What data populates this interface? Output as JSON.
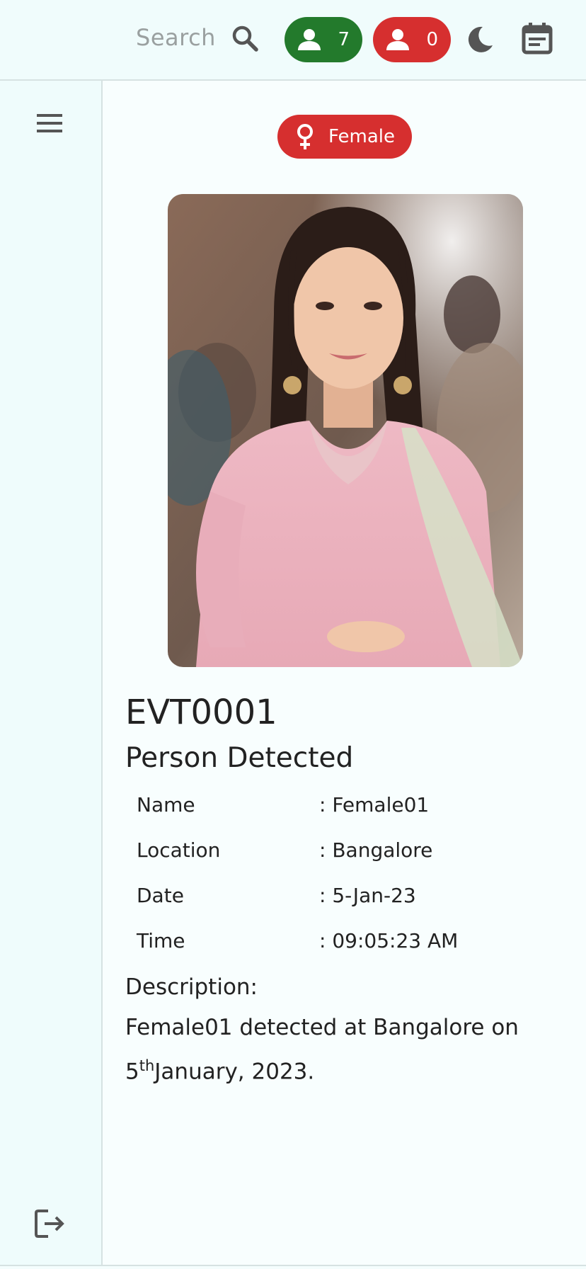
{
  "topbar": {
    "search_label": "Search",
    "icons": {
      "search": "search-icon",
      "theme": "moon-icon",
      "calendar": "calendar-icon"
    },
    "present_count": "7",
    "present_color": "#237a2c",
    "absent_count": "0",
    "absent_color": "#d62f2f"
  },
  "sidebar": {
    "menu_icon": "hamburger-menu-icon",
    "logout_icon": "logout-icon"
  },
  "event": {
    "gender_label": "Female",
    "gender_color": "#d62f2f",
    "id": "EVT0001",
    "title": "Person Detected",
    "details": [
      {
        "label": "Name",
        "value": ": Female01"
      },
      {
        "label": "Location",
        "value": ": Bangalore"
      },
      {
        "label": "Date",
        "value": ": 5-Jan-23"
      },
      {
        "label": "Time",
        "value": ": 09:05:23 AM"
      }
    ],
    "description_label": "Description:",
    "description_line1": "Female01 detected at Bangalore on",
    "description_day": "5",
    "description_suffix": "th",
    "description_rest": "January, 2023."
  }
}
